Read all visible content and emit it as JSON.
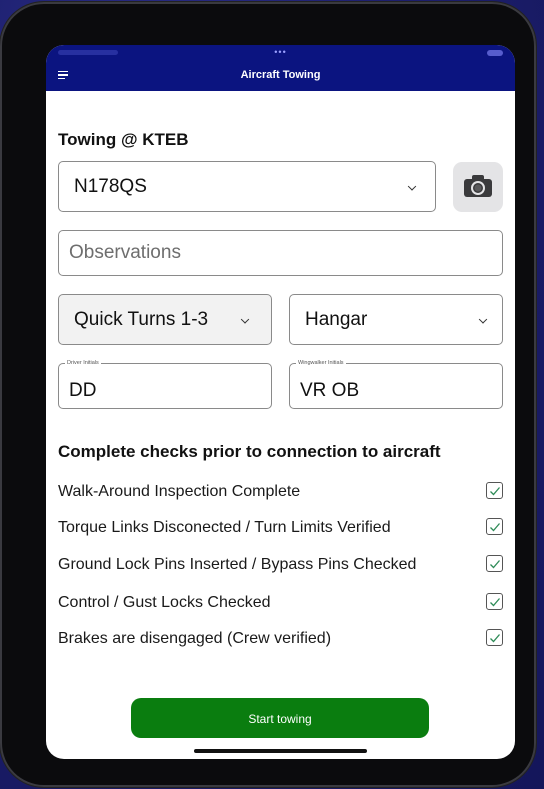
{
  "app": {
    "title": "Aircraft Towing"
  },
  "colors": {
    "nav_bg": "#0b1480",
    "button_green": "#0a7d0f",
    "check_green": "#2e8b57"
  },
  "form": {
    "heading": "Towing @  KTEB",
    "aircraft": {
      "value": "N178QS"
    },
    "camera_icon": "camera-icon",
    "observations": {
      "placeholder": "Observations"
    },
    "turn_type": {
      "value": "Quick Turns 1-3"
    },
    "location": {
      "value": "Hangar"
    },
    "driver_initials": {
      "label": "Driver Initials",
      "value": "DD"
    },
    "wingwalker_initials": {
      "label": "Wingwalker Initials",
      "value": "VR OB"
    }
  },
  "checks": {
    "title": "Complete checks prior to connection to aircraft",
    "items": [
      {
        "label": "Walk-Around Inspection Complete",
        "checked": true
      },
      {
        "label": "Torque Links Disconected / Turn Limits Verified",
        "checked": true
      },
      {
        "label": "Ground Lock Pins Inserted / Bypass Pins Checked",
        "checked": true
      },
      {
        "label": "Control / Gust Locks Checked",
        "checked": true
      },
      {
        "label": "Brakes are disengaged (Crew verified)",
        "checked": true
      }
    ]
  },
  "actions": {
    "start_label": "Start towing"
  }
}
